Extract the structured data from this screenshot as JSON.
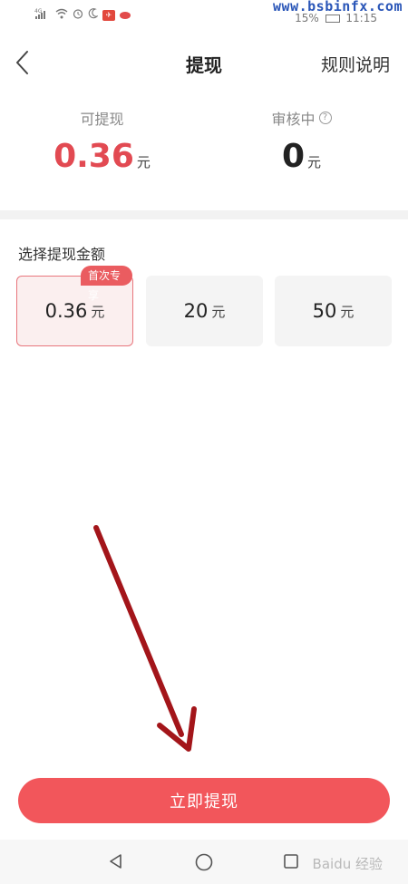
{
  "status_bar": {
    "carrier_icons": "⁴ᴳ",
    "battery_percent": "15%",
    "time": "11:15",
    "watermark_top": "www.bsbinfx.com"
  },
  "nav": {
    "title": "提现",
    "rules_label": "规则说明"
  },
  "balance": {
    "available_label": "可提现",
    "available_value": "0.36",
    "available_unit": "元",
    "review_label": "审核中",
    "review_value": "0",
    "review_unit": "元",
    "help_glyph": "?"
  },
  "amount_section": {
    "title": "选择提现金额",
    "badge": "首次专享",
    "options": [
      {
        "value": "0.36",
        "unit": "元",
        "selected": true
      },
      {
        "value": "20",
        "unit": "元",
        "selected": false
      },
      {
        "value": "50",
        "unit": "元",
        "selected": false
      }
    ]
  },
  "withdraw_button_label": "立即提现",
  "system_nav": {
    "watermark_bottom": "Baidu 经验"
  },
  "colors": {
    "accent": "#f2565b",
    "available_amount": "#e24a52",
    "annotation_arrow": "#a3151a"
  }
}
